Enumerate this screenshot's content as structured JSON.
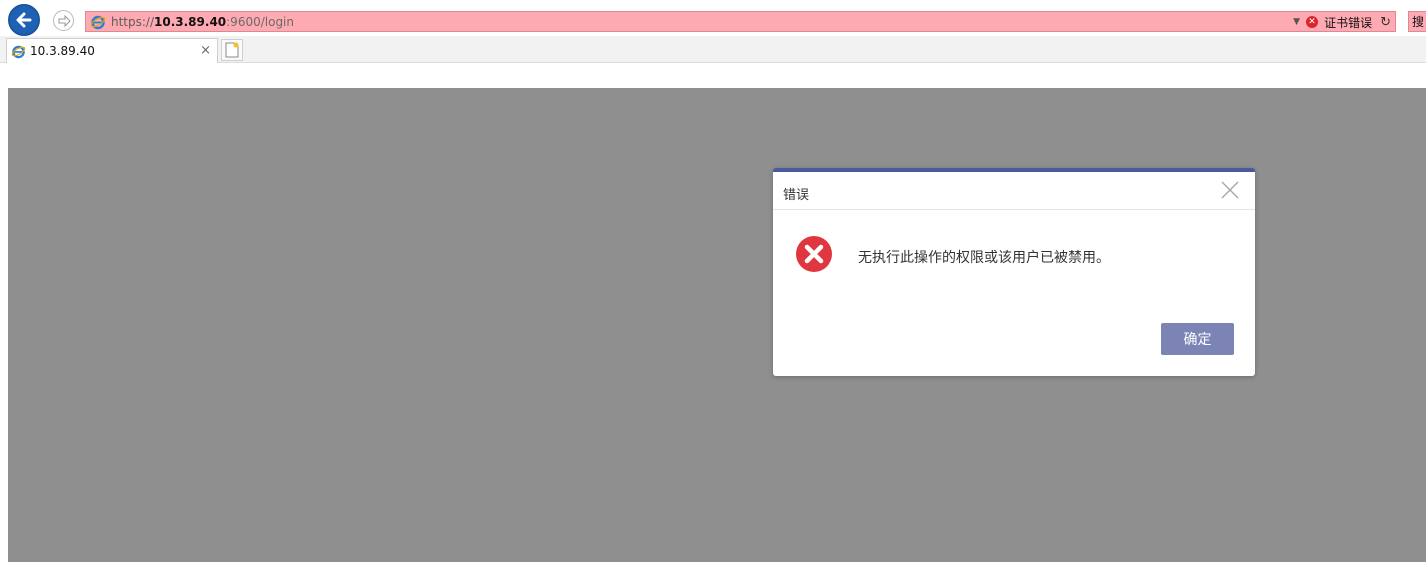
{
  "browser": {
    "url": {
      "protocol": "https://",
      "host": "10.3.89.40",
      "path": ":9600/login"
    },
    "cert_error_label": "证书错误",
    "search_label": "搜",
    "tab": {
      "title": "10.3.89.40",
      "close_label": "×"
    }
  },
  "dialog": {
    "title": "错误",
    "message": "无执行此操作的权限或该用户已被禁用。",
    "ok_label": "确定"
  },
  "colors": {
    "urlbar_bg": "#ffaab2",
    "page_bg": "#8f8f8f",
    "dialog_accent": "#4b5a9c",
    "ok_button": "#7c84b5",
    "error_icon": "#e0363f"
  },
  "icons": [
    "back-icon",
    "forward-icon",
    "ie-icon",
    "dropdown-icon",
    "cert-error-icon",
    "refresh-icon",
    "new-tab-icon",
    "close-icon",
    "error-icon"
  ]
}
